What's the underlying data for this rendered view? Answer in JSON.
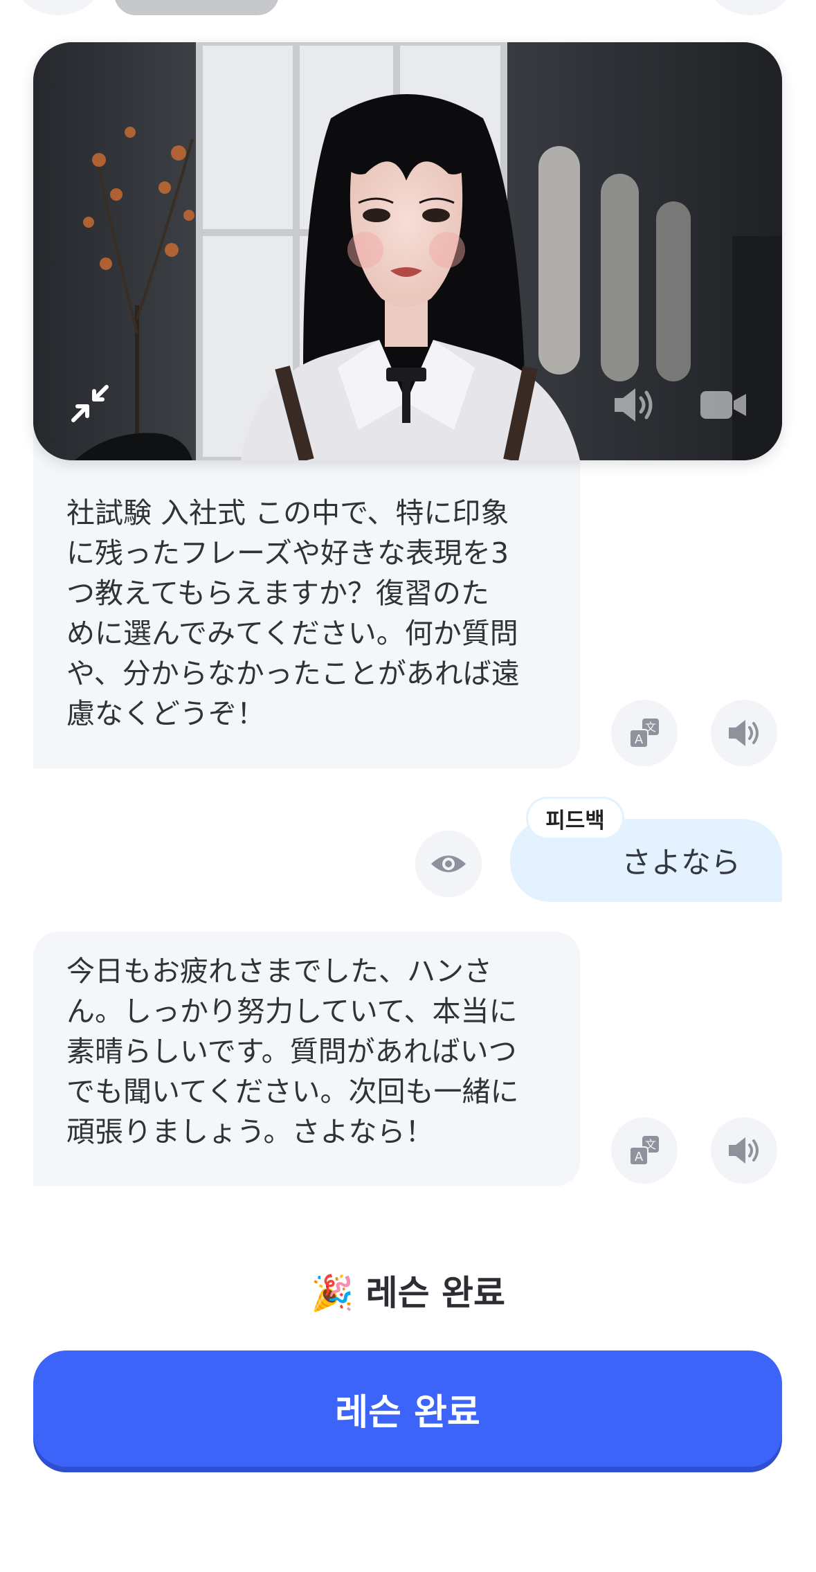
{
  "messages": [
    {
      "role": "ai",
      "text": "社試験 入社式 この中で、特に印象\nに残ったフレーズや好きな表現を3\nつ教えてもらえますか？復習のた\nめに選んでみてください。何か質問\nや、分からなかったことがあれば遠\n慮なくどうぞ！"
    },
    {
      "role": "user",
      "text": "さよなら",
      "tag": "피드백"
    },
    {
      "role": "ai",
      "text": "今日もお疲れさまでした、ハンさ\nん。しっかり努力していて、本当に\n素晴らしいです。質問があればいつ\nでも聞いてください。次回も一緒に\n頑張りましょう。さよなら！"
    }
  ],
  "icons": {
    "translate": "translate-icon",
    "speaker": "speaker-icon",
    "eye": "eye-icon",
    "minimize": "minimize-icon",
    "camera": "camera-icon",
    "party": "party-popper-icon"
  },
  "completion": {
    "emoji": "🎉",
    "label": "레슨 완료",
    "button_label": "레슨 완료"
  },
  "colors": {
    "primary": "#3c64f8",
    "user_bubble": "#e3f2fe",
    "ai_bubble": "#f4f6fa"
  }
}
